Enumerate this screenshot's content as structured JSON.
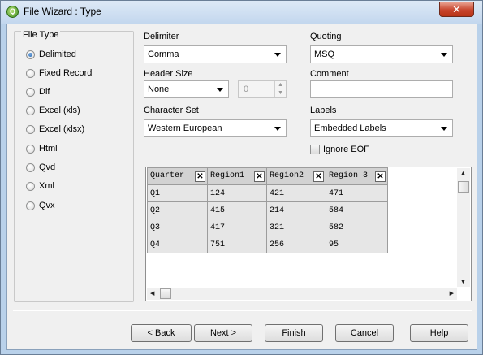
{
  "window": {
    "title": "File Wizard : Type",
    "close_glyph": "✕",
    "app_icon_glyph": "Q"
  },
  "file_type": {
    "title": "File Type",
    "options": [
      {
        "label": "Delimited",
        "checked": true
      },
      {
        "label": "Fixed Record",
        "checked": false
      },
      {
        "label": "Dif",
        "checked": false
      },
      {
        "label": "Excel (xls)",
        "checked": false
      },
      {
        "label": "Excel (xlsx)",
        "checked": false
      },
      {
        "label": "Html",
        "checked": false
      },
      {
        "label": "Qvd",
        "checked": false
      },
      {
        "label": "Xml",
        "checked": false
      },
      {
        "label": "Qvx",
        "checked": false
      }
    ]
  },
  "delimiter": {
    "label": "Delimiter",
    "value": "Comma"
  },
  "quoting": {
    "label": "Quoting",
    "value": "MSQ"
  },
  "header_size": {
    "label": "Header Size",
    "value": "None",
    "spin_value": "0"
  },
  "comment": {
    "label": "Comment",
    "value": ""
  },
  "character_set": {
    "label": "Character Set",
    "value": "Western European"
  },
  "labels": {
    "label": "Labels",
    "value": "Embedded Labels"
  },
  "ignore_eof": {
    "label": "Ignore EOF",
    "checked": false
  },
  "preview": {
    "columns": [
      "Quarter",
      "Region1",
      "Region2",
      "Region 3"
    ],
    "rows": [
      [
        "Q1",
        "124",
        "421",
        "471"
      ],
      [
        "Q2",
        "415",
        "214",
        "584"
      ],
      [
        "Q3",
        "417",
        "321",
        "582"
      ],
      [
        "Q4",
        "751",
        "256",
        "95"
      ]
    ],
    "remove_glyph": "✕"
  },
  "buttons": {
    "back": "< Back",
    "next": "Next >",
    "finish": "Finish",
    "cancel": "Cancel",
    "help": "Help"
  }
}
